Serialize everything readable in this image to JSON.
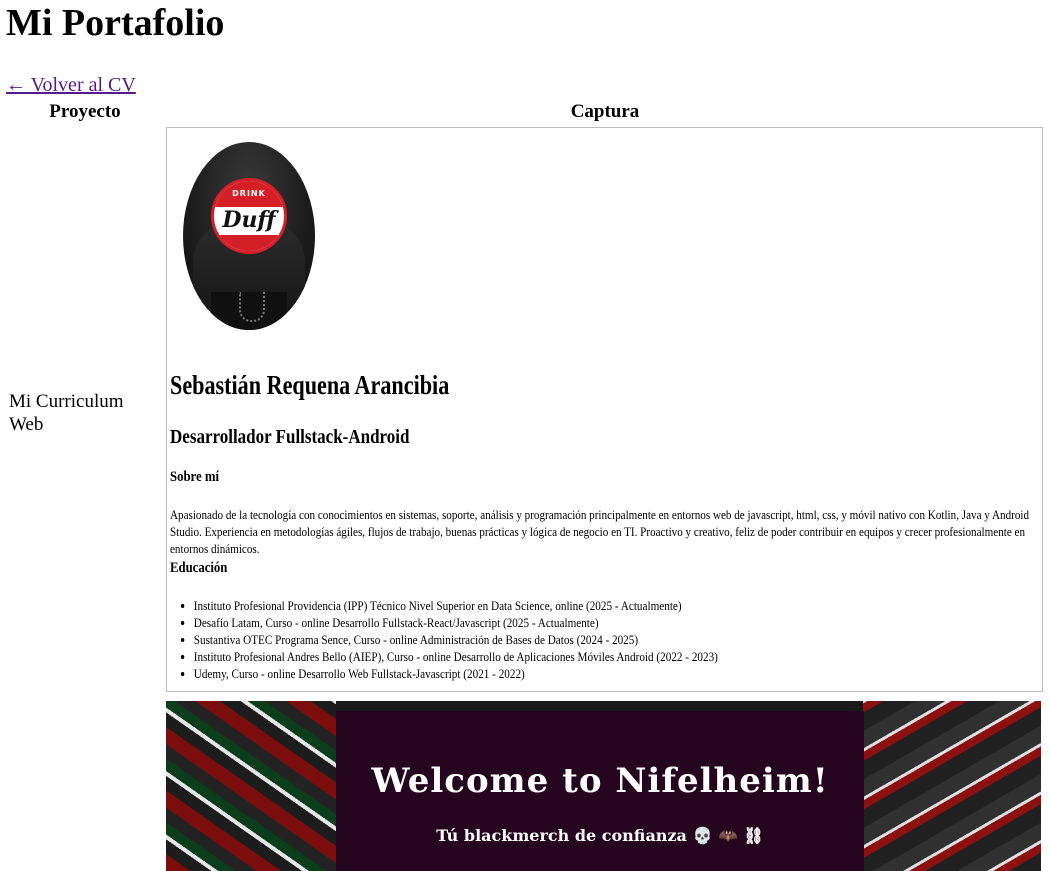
{
  "page": {
    "title": "Mi Portafolio",
    "back_link": "← Volver al CV"
  },
  "table": {
    "headers": [
      "Proyecto",
      "Captura"
    ],
    "rows": [
      {
        "project": "Mi Curriculum Web"
      }
    ]
  },
  "cv_screenshot": {
    "avatar_badge_top": "DRINK",
    "avatar_badge_word": "Duff",
    "name": "Sebastián Requena Arancibia",
    "role": "Desarrollador Fullstack-Android",
    "about_title": "Sobre mí",
    "about_text": "Apasionado de la tecnología con conocimientos en sistemas, soporte, análisis y programación principalmente en entornos web de javascript, html, css, y móvil nativo con Kotlin, Java y Android Studio. Experiencia en metodologías ágiles, flujos de trabajo, buenas prácticas y lógica de negocio en TI. Proactivo y creativo, feliz de poder contribuir en equipos y crecer profesionalmente en entornos dinámicos.",
    "education_title": "Educación",
    "education": [
      "Instituto Profesional Providencia (IPP) Técnico Nivel Superior en Data Science, online (2025 - Actualmente)",
      "Desafío Latam, Curso - online Desarrollo Fullstack-React/Javascript (2025 - Actualmente)",
      "Sustantiva OTEC Programa Sence, Curso - online Administración de Bases de Datos (2024 - 2025)",
      "Instituto Profesional Andres Bello (AIEP), Curso - online Desarrollo de Aplicaciones Móviles Android (2022 - 2023)",
      "Udemy, Curso - online Desarrollo Web Fullstack-Javascript (2021 - 2022)"
    ]
  },
  "store_screenshot": {
    "title": "Welcome to Nifelheim!",
    "subtitle": "Tú blackmerch de confianza 💀 🦇 ⛓"
  }
}
